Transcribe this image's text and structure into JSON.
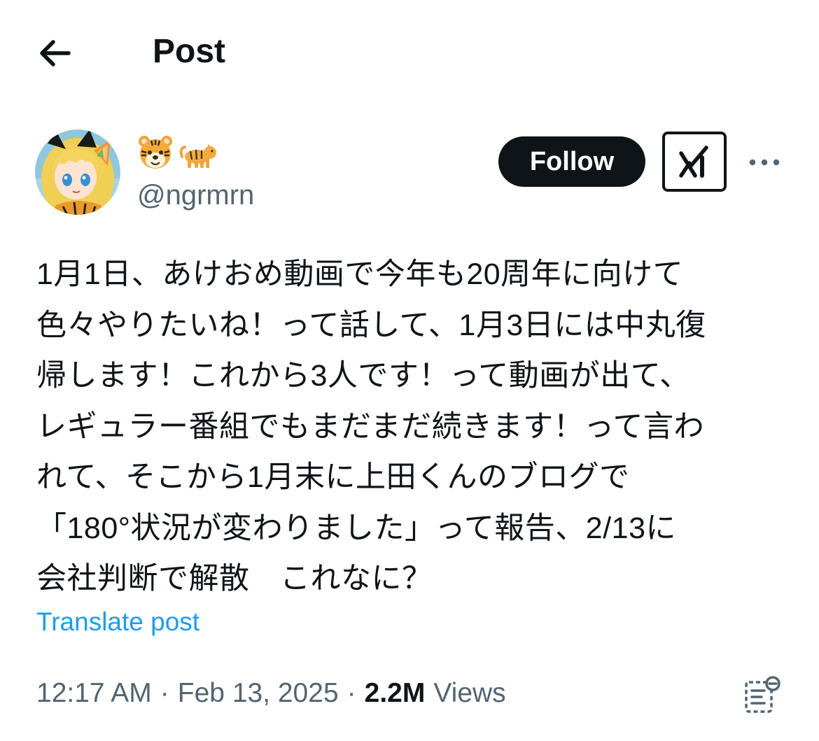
{
  "header": {
    "title": "Post",
    "back_icon": "arrow-left-icon"
  },
  "author": {
    "avatar_icon": "avatar-image",
    "display_name_icons": [
      "tiger-face-emoji",
      "tiger-emoji"
    ],
    "handle": "@ngrmrn",
    "follow_label": "Follow",
    "grok_icon": "grok-icon",
    "more_icon": "more-horizontal-icon"
  },
  "post": {
    "text": "1月1日、あけおめ動画で今年も20周年に向けて\n色々やりたいね！って話して、1月3日には中丸復\n帰します！これから3人です！って動画が出て、\nレギュラー番組でもまだまだ続きます！って言わ\nれて、そこから1月末に上田くんのブログで\n「180°状況が変わりました」って報告、2/13に\n会社判断で解散　これなに？",
    "translate_label": "Translate post"
  },
  "meta": {
    "time": "12:17 AM",
    "separator": "·",
    "date": "Feb 13, 2025",
    "views_count": "2.2M",
    "views_label": "Views",
    "analytics_icon": "post-analytics-icon"
  },
  "colors": {
    "text_primary": "#0f1419",
    "text_secondary": "#536471",
    "link": "#1d9bf0",
    "follow_bg": "#0f1419",
    "background": "#ffffff"
  }
}
